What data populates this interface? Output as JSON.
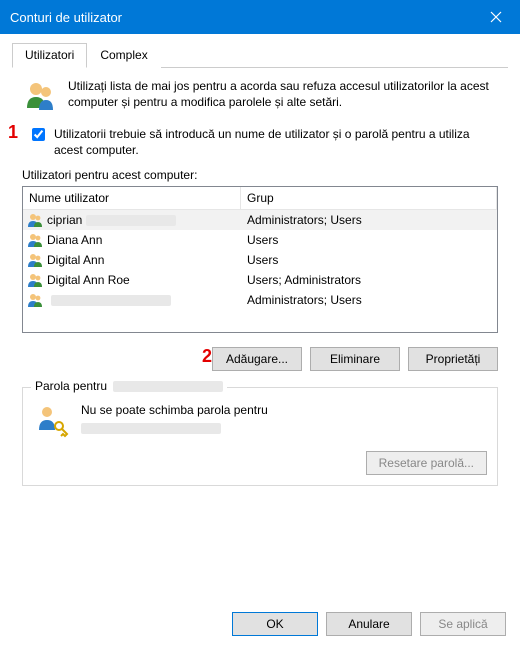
{
  "window": {
    "title": "Conturi de utilizator"
  },
  "tabs": [
    {
      "label": "Utilizatori",
      "active": true
    },
    {
      "label": "Complex",
      "active": false
    }
  ],
  "intro": "Utilizați lista de mai jos pentru a acorda sau refuza accesul utilizatorilor la acest computer și pentru a modifica parolele și alte setări.",
  "require_login": {
    "checked": true,
    "label": "Utilizatorii trebuie să introducă un nume de utilizator și o parolă pentru a utiliza acest computer."
  },
  "list": {
    "caption": "Utilizatori pentru acest computer:",
    "columns": {
      "name": "Nume utilizator",
      "group": "Grup"
    },
    "rows": [
      {
        "name": "ciprian",
        "name_redacted_suffix": true,
        "group": "Administrators; Users",
        "selected": true
      },
      {
        "name": "Diana Ann",
        "group": "Users"
      },
      {
        "name": "Digital Ann",
        "group": "Users"
      },
      {
        "name": "Digital Ann Roe",
        "group": "Users; Administrators"
      },
      {
        "name": "",
        "name_redacted_suffix": true,
        "group": "Administrators; Users"
      }
    ]
  },
  "buttons": {
    "add": "Adăugare...",
    "remove": "Eliminare",
    "properties": "Proprietăți"
  },
  "password_box": {
    "legend": "Parola pentru",
    "message": "Nu se poate schimba parola pentru",
    "reset_btn": "Resetare parolă...",
    "reset_enabled": false
  },
  "footer": {
    "ok": "OK",
    "cancel": "Anulare",
    "apply": "Se aplică",
    "apply_enabled": false
  },
  "annotations": {
    "one": "1",
    "two": "2"
  }
}
